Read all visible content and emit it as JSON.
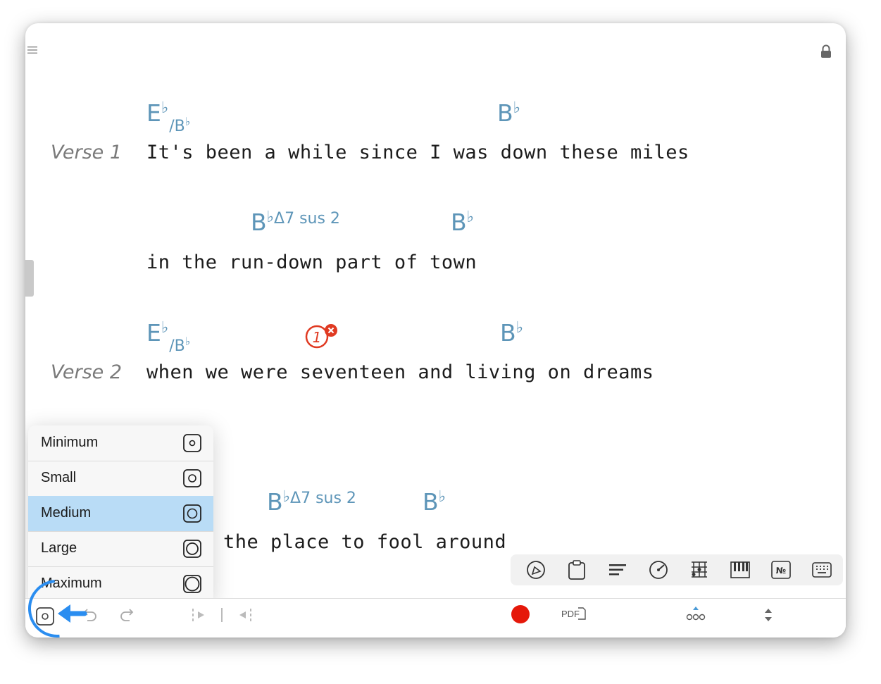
{
  "header": {
    "menu_icon": "hamburger-icon",
    "lock_icon": "lock-icon"
  },
  "sections": [
    {
      "label": "Verse 1",
      "lines": [
        {
          "lyric": "It's been a while since I was down these miles",
          "chords": [
            {
              "root": "E",
              "acc": "♭",
              "bass": "B",
              "bass_acc": "♭"
            },
            {
              "root": "B",
              "acc": "♭"
            }
          ]
        },
        {
          "lyric": "in the run-down part of town",
          "chords": [
            {
              "root": "B",
              "acc": "♭",
              "ext": "Δ7 sus 2"
            },
            {
              "root": "B",
              "acc": "♭"
            }
          ]
        }
      ]
    },
    {
      "label": "Verse 2",
      "lines": [
        {
          "lyric": "when we were seventeen and living on dreams",
          "chords": [
            {
              "root": "E",
              "acc": "♭",
              "bass": "B",
              "bass_acc": "♭"
            },
            {
              "root": "B",
              "acc": "♭"
            }
          ],
          "error_badge": "1"
        },
        {
          "lyric": "the place to fool around",
          "chords": [
            {
              "root": "B",
              "acc": "♭",
              "ext": "Δ7 sus 2"
            },
            {
              "root": "B",
              "acc": "♭"
            }
          ]
        }
      ]
    }
  ],
  "size_menu": {
    "items": [
      "Minimum",
      "Small",
      "Medium",
      "Large",
      "Maximum"
    ],
    "selected": "Medium"
  },
  "edit_toolbar": [
    "pen-icon",
    "clipboard-icon",
    "align-icon",
    "tempo-dial-icon",
    "chord-grid-icon",
    "piano-icon",
    "number-icon",
    "keyboard-icon"
  ],
  "bottom_bar": {
    "pdf_label": "PDF",
    "icons": [
      "size-icon",
      "undo-icon",
      "redo-icon",
      "play-cursor-icon",
      "cursor-bar-icon",
      "rewind-cursor-icon",
      "record-icon",
      "pdf-icon",
      "more-icon",
      "reorder-icon"
    ]
  },
  "colors": {
    "chord": "#5d95b8",
    "selected": "#b9dcf6",
    "record": "#e5180a",
    "accent": "#2a8df0",
    "error": "#e03a22"
  }
}
